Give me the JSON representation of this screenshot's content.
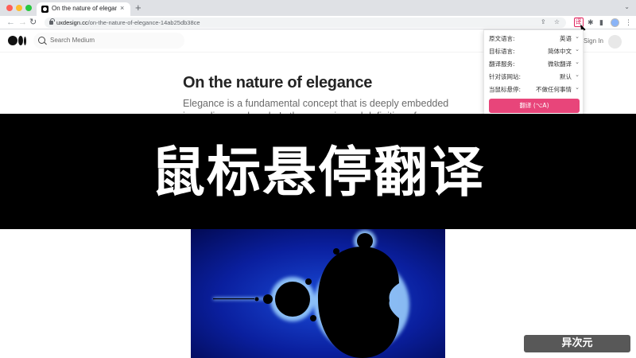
{
  "browser": {
    "tab_title": "On the nature of elegance. Ele",
    "tab_close": "×",
    "new_tab": "+",
    "tabstrip_menu": "⌄",
    "nav_back": "←",
    "nav_forward": "→",
    "nav_reload": "↻",
    "url_domain": "uxdesign.cc",
    "url_path": "/on-the-nature-of-elegance-14ab25db38ce",
    "omni_share": "⇪",
    "omni_bookmark": "☆",
    "puzzle": "✱",
    "sidebar": "▮",
    "menu": "⋮"
  },
  "medium": {
    "search_placeholder": "Search Medium",
    "sign_in": "Sign In"
  },
  "article": {
    "title": "On the nature of elegance",
    "subtitle": "Elegance is a fundamental concept that is deeply embedded in our lives and work. Is there a universal definition of elegance?"
  },
  "popup": {
    "rows": [
      {
        "label": "原文语言:",
        "value": "英语"
      },
      {
        "label": "目标语言:",
        "value": "简体中文"
      },
      {
        "label": "翻译服务:",
        "value": "微软翻译"
      },
      {
        "label": "针对该网站:",
        "value": "默认"
      },
      {
        "label": "当鼠标悬停:",
        "value": "不做任何事情"
      }
    ],
    "chevron": "⌄",
    "translate_button": "翻译 (⌥A)",
    "accent": "#e8457a"
  },
  "banner": {
    "text": "鼠标悬停翻译"
  },
  "watermark": {
    "text": "异次元 iPlaySoft.com"
  }
}
